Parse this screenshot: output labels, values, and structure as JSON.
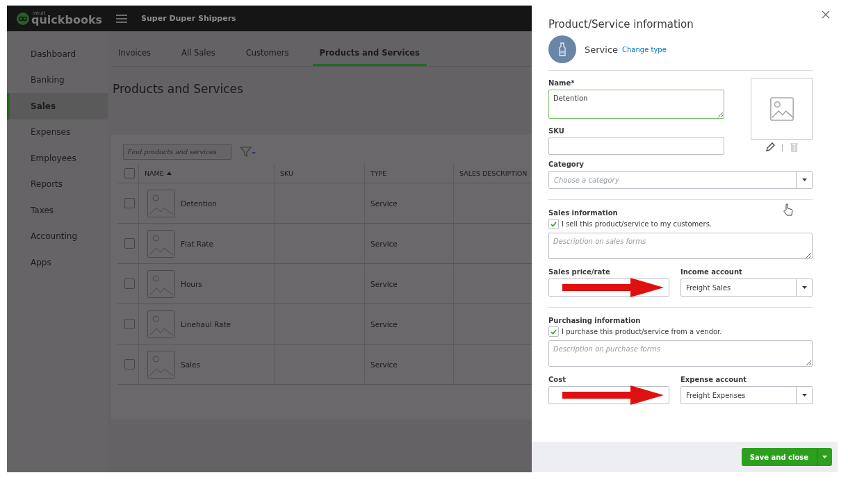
{
  "header": {
    "logo": {
      "small": "intuit",
      "name": "quickbooks"
    },
    "company": "Super Duper Shippers"
  },
  "sidebar": {
    "items": [
      {
        "label": "Dashboard",
        "selected": false
      },
      {
        "label": "Banking",
        "selected": false
      },
      {
        "label": "Sales",
        "selected": true
      },
      {
        "label": "Expenses",
        "selected": false
      },
      {
        "label": "Employees",
        "selected": false
      },
      {
        "label": "Reports",
        "selected": false
      },
      {
        "label": "Taxes",
        "selected": false
      },
      {
        "label": "Accounting",
        "selected": false
      },
      {
        "label": "Apps",
        "selected": false
      }
    ]
  },
  "tabs": [
    {
      "label": "Invoices",
      "selected": false
    },
    {
      "label": "All Sales",
      "selected": false
    },
    {
      "label": "Customers",
      "selected": false
    },
    {
      "label": "Products and Services",
      "selected": true
    }
  ],
  "page_title": "Products and Services",
  "search": {
    "placeholder": "Find products and services"
  },
  "table": {
    "select_all_checked": false,
    "columns": [
      {
        "label": "NAME",
        "sorted": true
      },
      {
        "label": "SKU",
        "sorted": false
      },
      {
        "label": "TYPE",
        "sorted": false
      },
      {
        "label": "SALES DESCRIPTION",
        "sorted": false
      }
    ],
    "rows": [
      {
        "name": "Detention",
        "type": "Service",
        "checked": false
      },
      {
        "name": "Flat Rate",
        "type": "Service",
        "checked": false
      },
      {
        "name": "Hours",
        "type": "Service",
        "checked": false
      },
      {
        "name": "Linehaul Rate",
        "type": "Service",
        "checked": false
      },
      {
        "name": "Sales",
        "type": "Service",
        "checked": false
      }
    ]
  },
  "panel": {
    "title": "Product/Service information",
    "type_label": "Service",
    "change_type": "Change type",
    "name": {
      "label": "Name*",
      "value": "Detention",
      "focused": true
    },
    "sku": {
      "label": "SKU"
    },
    "category": {
      "label": "Category",
      "placeholder": "Choose a category"
    },
    "sections": [
      {
        "heading": "Sales information",
        "checkbox": {
          "label": "I sell this product/service to my customers.",
          "checked": true
        },
        "description_placeholder": "Description on sales forms",
        "price_label": "Sales price/rate",
        "account_label": "Income account",
        "account": "Freight Sales"
      },
      {
        "heading": "Purchasing information",
        "checkbox": {
          "label": "I purchase this product/service from a vendor.",
          "checked": true
        },
        "description_placeholder": "Description on purchase forms",
        "price_label": "Cost",
        "account_label": "Expense account",
        "account": "Freight Expenses"
      }
    ],
    "save_button": "Save and close"
  }
}
